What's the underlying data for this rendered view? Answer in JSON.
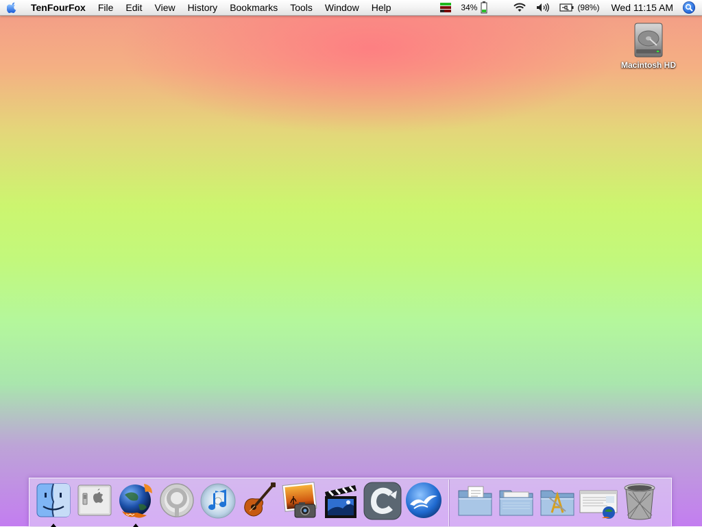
{
  "menubar": {
    "apple_icon": "apple-logo-icon",
    "app_name": "TenFourFox",
    "menus": [
      "File",
      "Edit",
      "View",
      "History",
      "Bookmarks",
      "Tools",
      "Window",
      "Help"
    ],
    "status": {
      "cpu_meter_icon": "cpu-meter-icon",
      "battery_percent": "34%",
      "wifi_icon": "wifi-icon",
      "volume_icon": "volume-icon",
      "power_percent": "(98%)",
      "clock": "Wed 11:15 AM",
      "spotlight_icon": "spotlight-icon"
    }
  },
  "desktop": {
    "icons": [
      {
        "label": "Macintosh HD",
        "icon": "hard-drive-icon"
      }
    ],
    "wallpaper_colors": [
      "#f39a88",
      "#ccf56f",
      "#a9e6ad",
      "#c37df0"
    ]
  },
  "dock": {
    "apps": [
      {
        "name": "Finder",
        "icon": "finder-icon",
        "running": true
      },
      {
        "name": "System Preferences",
        "icon": "system-preferences-icon",
        "running": false
      },
      {
        "name": "TenFourFox",
        "icon": "tenfourfox-icon",
        "running": true
      },
      {
        "name": "Camino",
        "icon": "camino-icon",
        "running": false
      },
      {
        "name": "iTunes",
        "icon": "itunes-icon",
        "running": false
      },
      {
        "name": "GarageBand",
        "icon": "garageband-icon",
        "running": false
      },
      {
        "name": "iPhoto",
        "icon": "iphoto-icon",
        "running": false
      },
      {
        "name": "iMovie",
        "icon": "imovie-icon",
        "running": false
      },
      {
        "name": "Classilla",
        "icon": "classilla-icon",
        "running": false
      },
      {
        "name": "OpenOffice",
        "icon": "openoffice-icon",
        "running": false
      }
    ],
    "others": [
      {
        "name": "Documents",
        "icon": "documents-folder-icon"
      },
      {
        "name": "Downloads",
        "icon": "folder-icon"
      },
      {
        "name": "Applications",
        "icon": "applications-folder-icon"
      },
      {
        "name": "Web Page",
        "icon": "web-page-icon"
      },
      {
        "name": "Trash",
        "icon": "trash-icon"
      }
    ]
  }
}
